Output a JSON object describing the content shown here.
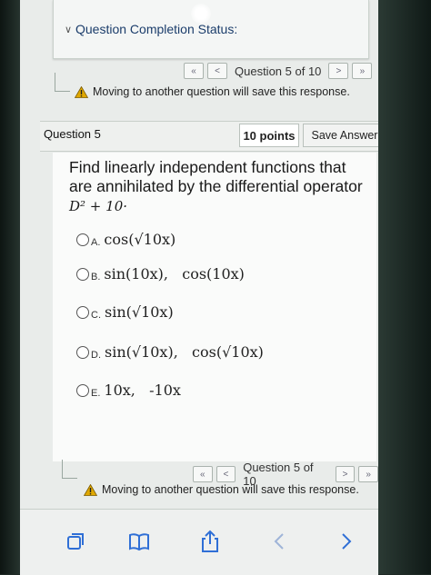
{
  "status": {
    "title": "Question Completion Status:"
  },
  "pager_top": {
    "label": "Question 5 of 10",
    "first": "«",
    "prev": "<",
    "next": ">",
    "last": "»"
  },
  "notice_top": "Moving to another question will save this response.",
  "question": {
    "number": "Question 5",
    "points": "10 points",
    "save_label": "Save Answer",
    "text": "Find linearly independent functions that are annihilated by the differential operator",
    "operator": "D² + 10·"
  },
  "options": [
    {
      "letter": "A.",
      "math": "cos(√10x)"
    },
    {
      "letter": "B.",
      "math": "sin(10x),   cos(10x)"
    },
    {
      "letter": "C.",
      "math": "sin(√10x)"
    },
    {
      "letter": "D.",
      "math": "sin(√10x),   cos(√10x)"
    },
    {
      "letter": "E.",
      "math": "10x,   -10x"
    }
  ],
  "pager_bottom": {
    "label": "Question 5 of 10",
    "first": "«",
    "prev": "<",
    "next": ">",
    "last": "»"
  },
  "notice_bottom": "Moving to another question will save this response.",
  "colors": {
    "warning": "#e0a800",
    "title": "#1b3d6b",
    "nav_icon": "#2f6fd6"
  },
  "icons": [
    "chevron-down-icon",
    "warning-icon",
    "tabs-icon",
    "bookmarks-icon",
    "share-icon",
    "back-arrow-icon",
    "forward-arrow-icon"
  ]
}
